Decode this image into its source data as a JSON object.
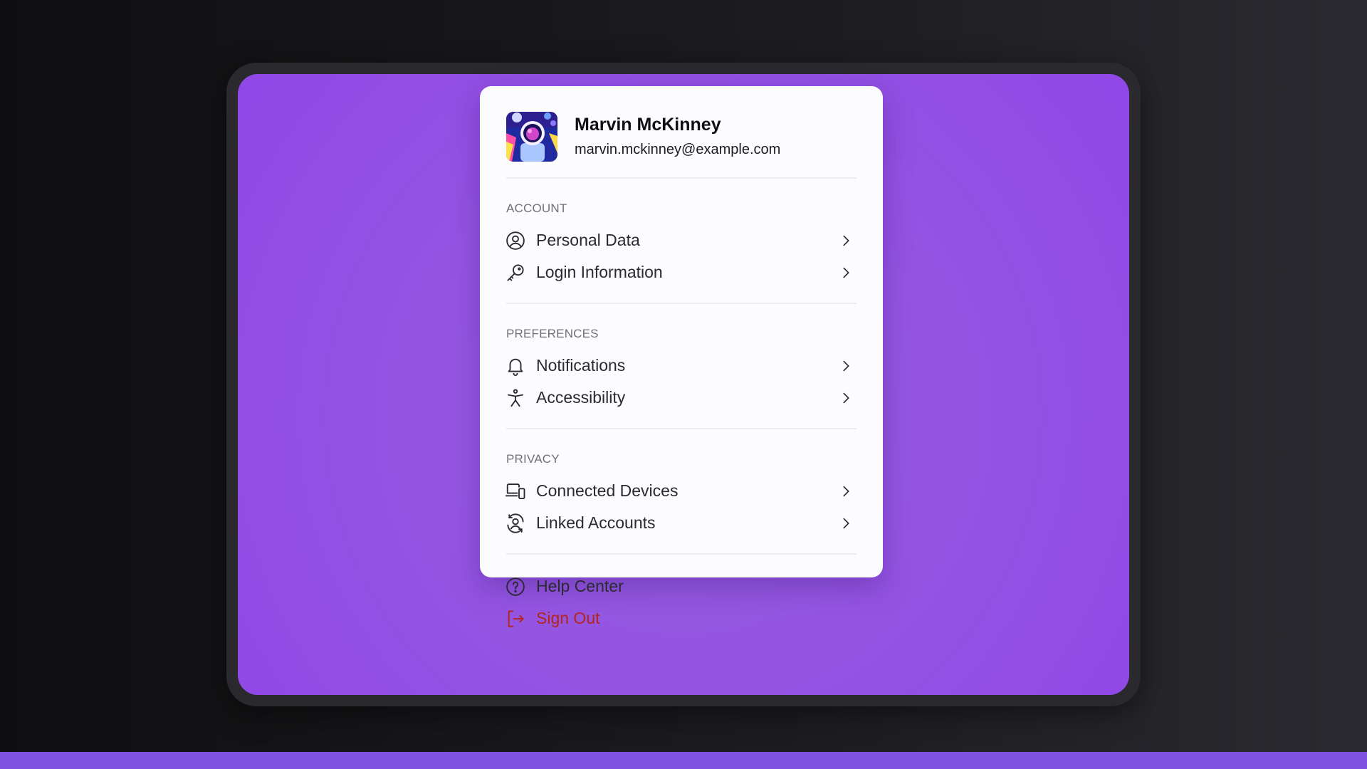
{
  "profile": {
    "name": "Marvin McKinney",
    "email": "marvin.mckinney@example.com"
  },
  "sections": {
    "account": {
      "title": "ACCOUNT",
      "items": [
        {
          "label": "Personal Data",
          "icon": "user-circle-icon"
        },
        {
          "label": "Login Information",
          "icon": "key-icon"
        }
      ]
    },
    "preferences": {
      "title": "PREFERENCES",
      "items": [
        {
          "label": "Notifications",
          "icon": "bell-icon"
        },
        {
          "label": "Accessibility",
          "icon": "accessibility-icon"
        }
      ]
    },
    "privacy": {
      "title": "PRIVACY",
      "items": [
        {
          "label": "Connected Devices",
          "icon": "devices-icon"
        },
        {
          "label": "Linked Accounts",
          "icon": "linked-accounts-icon"
        }
      ]
    },
    "footer": {
      "items": [
        {
          "label": "Help Center",
          "icon": "help-circle-icon"
        },
        {
          "label": "Sign Out",
          "icon": "sign-out-icon"
        }
      ]
    }
  },
  "colors": {
    "accent": "#9152e1",
    "danger": "#b3261e"
  }
}
